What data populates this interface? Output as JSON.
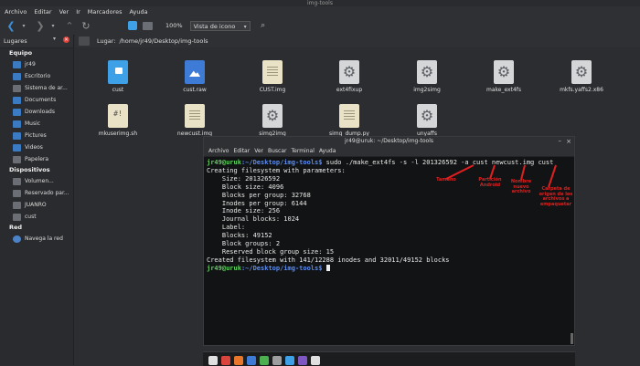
{
  "window": {
    "title": "img-tools"
  },
  "menu": [
    "Archivo",
    "Editar",
    "Ver",
    "Ir",
    "Marcadores",
    "Ayuda"
  ],
  "toolbar": {
    "zoom": "100%",
    "view_mode": "Vista de icono"
  },
  "sidebar": {
    "header": "Lugares",
    "sections": [
      {
        "title": "Equipo",
        "items": [
          "jr49",
          "Escritorio",
          "Sistema de ar...",
          "Documents",
          "Downloads",
          "Music",
          "Pictures",
          "Videos",
          "Papelera"
        ]
      },
      {
        "title": "Dispositivos",
        "items": [
          "Volumen...",
          "Reservado par...",
          "JUANRO",
          "cust"
        ]
      },
      {
        "title": "Red",
        "items": [
          "Navega la red"
        ]
      }
    ]
  },
  "location": {
    "label": "Lugar:",
    "path": "/home/jr49/Desktop/img-tools"
  },
  "files": [
    {
      "name": "cust",
      "icon": "folder-icon"
    },
    {
      "name": "cust.raw",
      "icon": "image-file-icon"
    },
    {
      "name": "CUST.img",
      "icon": "document-icon"
    },
    {
      "name": "ext4fixup",
      "icon": "executable-icon"
    },
    {
      "name": "img2simg",
      "icon": "executable-icon"
    },
    {
      "name": "make_ext4fs",
      "icon": "executable-icon"
    },
    {
      "name": "mkfs.yaffs2.x86",
      "icon": "executable-icon"
    },
    {
      "name": "mkuserimg.sh",
      "icon": "script-icon"
    },
    {
      "name": "newcust.img",
      "icon": "document-icon"
    },
    {
      "name": "simg2img",
      "icon": "executable-icon"
    },
    {
      "name": "simg_dump.py",
      "icon": "document-icon"
    },
    {
      "name": "unyaffs",
      "icon": "executable-icon"
    }
  ],
  "terminal": {
    "title": "jr49@uruk: ~/Desktop/img-tools",
    "menu": [
      "Archivo",
      "Editar",
      "Ver",
      "Buscar",
      "Terminal",
      "Ayuda"
    ],
    "prompt_user": "jr49@uruk",
    "prompt_path": ":~/Desktop/img-tools$",
    "command": " sudo ./make_ext4fs -s -l 201326592 -a cust newcust.img cust",
    "output": [
      "Creating filesystem with parameters:",
      "    Size: 201326592",
      "    Block size: 4096",
      "    Blocks per group: 32768",
      "    Inodes per group: 6144",
      "    Inode size: 256",
      "    Journal blocks: 1024",
      "    Label:",
      "    Blocks: 49152",
      "    Block groups: 2",
      "    Reserved block group size: 15",
      "Created filesystem with 141/12288 inodes and 32011/49152 blocks"
    ]
  },
  "annotations": [
    {
      "text": "Tamaño"
    },
    {
      "text": "Partición Android"
    },
    {
      "text": "Nombre nuevo archivo"
    },
    {
      "text": "Carpeta de origen de los archivos a empaquetar"
    }
  ]
}
